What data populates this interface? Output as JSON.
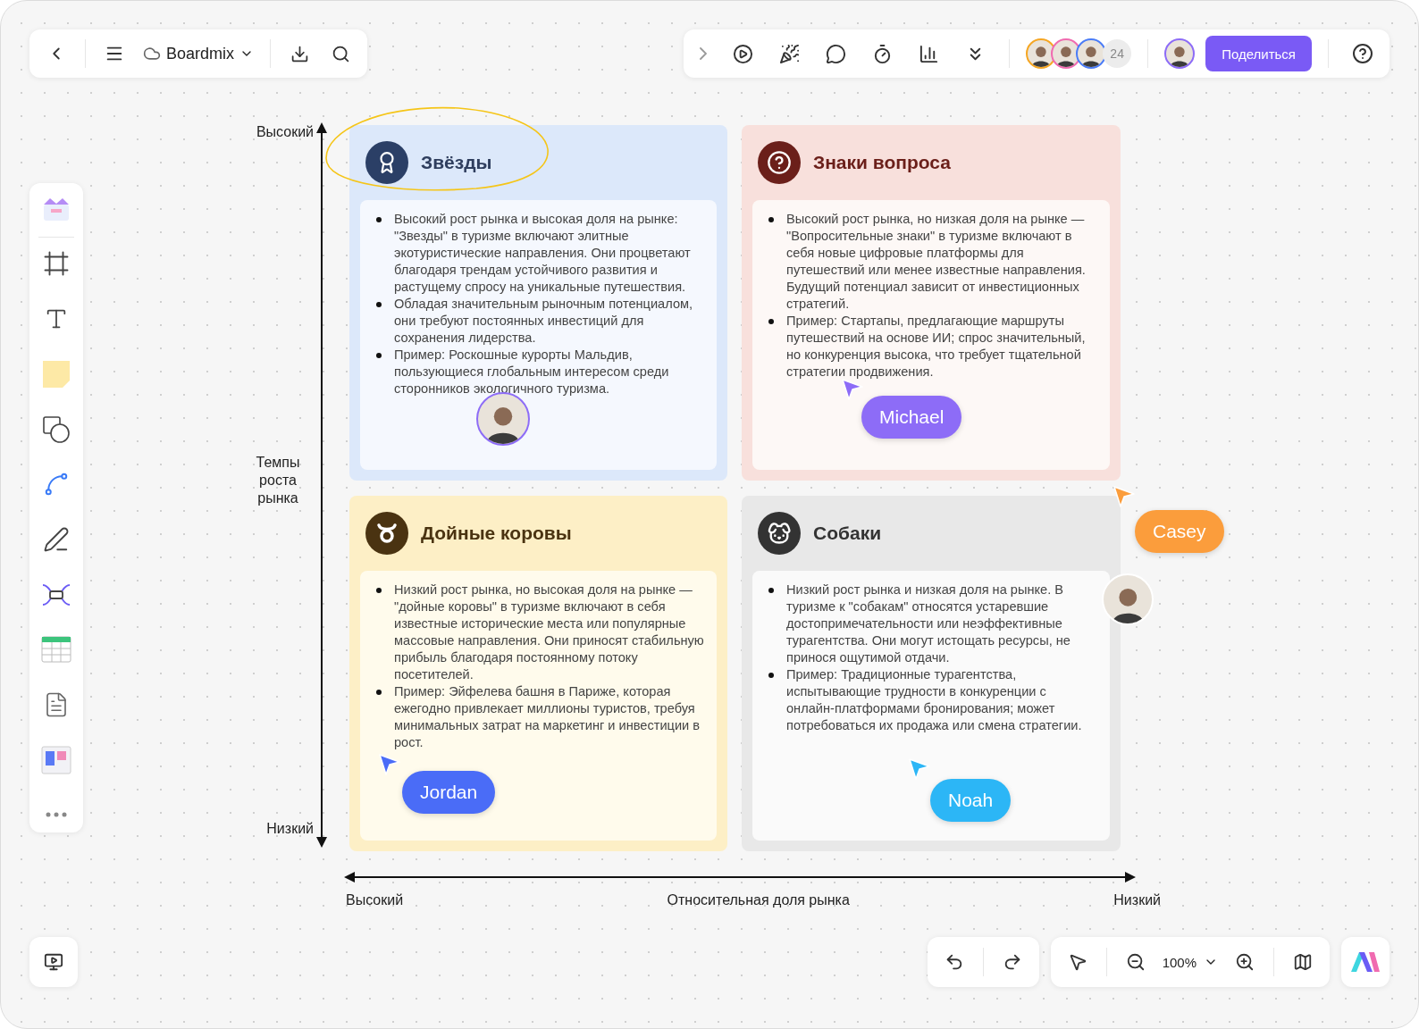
{
  "toolbar_left": {
    "file_name": "Boardmix"
  },
  "toolbar_right": {
    "collaborator_count": "24",
    "share_button": "Поделиться"
  },
  "matrix": {
    "y_axis": {
      "top": "Высокий",
      "title": "Темпы роста рынка",
      "bottom": "Низкий"
    },
    "x_axis": {
      "left": "Высокий",
      "title": "Относительная доля рынка",
      "right": "Низкий"
    },
    "quadrants": [
      {
        "kind": "stars",
        "title": "Звёзды",
        "color": "#dce8fa",
        "bullets": [
          "Высокий рост рынка и высокая доля на рынке: \"Звезды\" в туризме включают элитные экотуристические направления. Они процветают благодаря трендам устойчивого развития и растущему спросу на уникальные путешествия.",
          "Обладая значительным рыночным потенциалом, они требуют постоянных инвестиций для сохранения лидерства.",
          "Пример: Роскошные курорты Мальдив, пользующиеся глобальным интересом среди сторонников экологичного туризма."
        ]
      },
      {
        "kind": "question",
        "title": "Знаки вопроса",
        "color": "#f8e0dc",
        "bullets": [
          "Высокий рост рынка, но низкая доля на рынке — \"Вопросительные знаки\" в туризме включают в себя новые цифровые платформы для путешествий или менее известные направления. Будущий потенциал зависит от инвестиционных стратегий.",
          "Пример: Стартапы, предлагающие маршруты путешествий на основе ИИ; спрос значительный, но конкуренция высока, что требует тщательной стратегии продвижения."
        ]
      },
      {
        "kind": "cow",
        "title": "Дойные коровы",
        "color": "#fdefc6",
        "bullets": [
          "Низкий рост рынка, но высокая доля на рынке — \"дойные коровы\" в туризме включают в себя известные исторические места или популярные массовые направления. Они приносят стабильную прибыль благодаря постоянному потоку посетителей.",
          "Пример: Эйфелева башня в Париже, которая ежегодно привлекает миллионы туристов, требуя минимальных затрат на маркетинг и инвестиции в рост."
        ]
      },
      {
        "kind": "dog",
        "title": "Собаки",
        "color": "#e8e8e8",
        "bullets": [
          "Низкий рост рынка и низкая доля на рынке. В туризме к \"собакам\" относятся устаревшие достопримечательности или неэффективные турагентства. Они могут истощать ресурсы, не принося ощутимой отдачи.",
          "Пример: Традиционные турагентства, испытывающие трудности в конкуренции с онлайн-платформами бронирования; может потребоваться их продажа или смена стратегии."
        ]
      }
    ]
  },
  "cursors": [
    {
      "name": "Michael",
      "color": "#8d6cf7"
    },
    {
      "name": "Casey",
      "color": "#fb9d3c"
    },
    {
      "name": "Jordan",
      "color": "#4a6cf7"
    },
    {
      "name": "Noah",
      "color": "#2cb6f6"
    }
  ],
  "zoom": {
    "value": "100%"
  }
}
